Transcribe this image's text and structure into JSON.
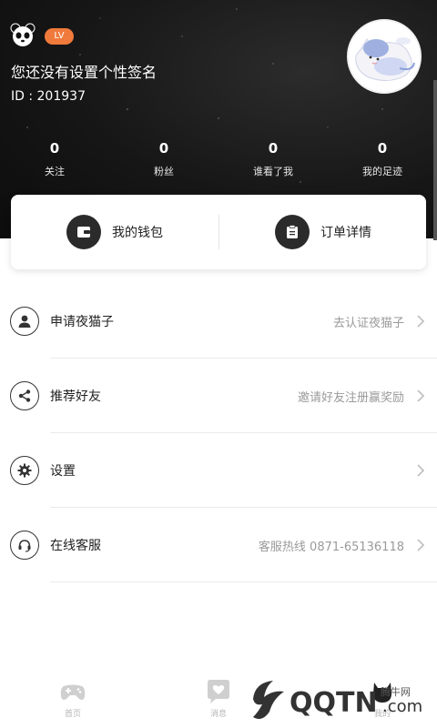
{
  "header": {
    "level_badge": "LV",
    "signature": "您还没有设置个性签名",
    "user_id": "ID : 201937"
  },
  "stats": [
    {
      "value": "0",
      "label": "关注"
    },
    {
      "value": "0",
      "label": "粉丝"
    },
    {
      "value": "0",
      "label": "谁看了我"
    },
    {
      "value": "0",
      "label": "我的足迹"
    }
  ],
  "card": {
    "wallet_label": "我的钱包",
    "orders_label": "订单详情"
  },
  "menu": [
    {
      "title": "申请夜猫子",
      "value": "去认证夜猫子",
      "icon": "person-icon"
    },
    {
      "title": "推荐好友",
      "value": "邀请好友注册赢奖励",
      "icon": "share-icon"
    },
    {
      "title": "设置",
      "value": "",
      "icon": "gear-icon"
    },
    {
      "title": "在线客服",
      "value": "客服热线 0871-65136118",
      "icon": "headset-icon"
    }
  ],
  "tabbar": {
    "tabs": [
      {
        "label": "首页",
        "icon": "gamepad-icon"
      },
      {
        "label": "消息",
        "icon": "chat-heart-icon"
      },
      {
        "label": "",
        "icon": "tab-icon"
      },
      {
        "label": "我的",
        "icon": "profile-icon"
      }
    ]
  },
  "watermark": {
    "text": "腾牛网",
    "brand": "QQTN.com"
  },
  "colors": {
    "accent": "#f07a3c",
    "header_bg": "#161616",
    "card_icon_bg": "#2b2b2b",
    "muted_text": "#9a9a9a"
  }
}
